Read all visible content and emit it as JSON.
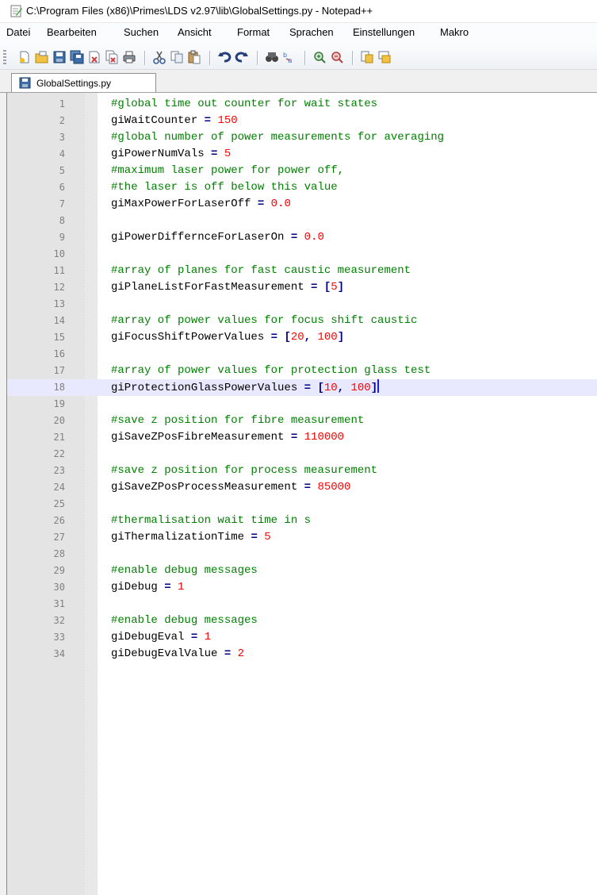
{
  "window": {
    "title": "C:\\Program Files (x86)\\Primes\\LDS v2.97\\lib\\GlobalSettings.py - Notepad++"
  },
  "menubar": {
    "items": [
      "Datei",
      "Bearbeiten",
      "Suchen",
      "Ansicht",
      "Format",
      "Sprachen",
      "Einstellungen",
      "Makro"
    ]
  },
  "toolbar": {
    "icons": [
      "new-file-icon",
      "open-file-icon",
      "save-icon",
      "save-all-icon",
      "close-icon",
      "close-all-icon",
      "print-icon",
      "cut-icon",
      "copy-icon",
      "paste-icon",
      "undo-icon",
      "redo-icon",
      "find-icon",
      "replace-icon",
      "zoom-in-icon",
      "zoom-out-icon",
      "sync-vertical-icon",
      "sync-horizontal-icon"
    ]
  },
  "tab": {
    "label": "GlobalSettings.py"
  },
  "editor": {
    "current_line": 18,
    "lines": [
      {
        "n": "1",
        "t": [
          [
            "c",
            "#global time out counter for wait states"
          ]
        ]
      },
      {
        "n": "2",
        "t": [
          [
            "i",
            "giWaitCounter "
          ],
          [
            "o",
            "="
          ],
          [
            "i",
            " "
          ],
          [
            "n",
            "150"
          ]
        ]
      },
      {
        "n": "3",
        "t": [
          [
            "c",
            "#global number of power measurements for averaging"
          ]
        ]
      },
      {
        "n": "4",
        "t": [
          [
            "i",
            "giPowerNumVals "
          ],
          [
            "o",
            "="
          ],
          [
            "i",
            " "
          ],
          [
            "n",
            "5"
          ]
        ]
      },
      {
        "n": "5",
        "t": [
          [
            "c",
            "#maximum laser power for power off,"
          ]
        ]
      },
      {
        "n": "6",
        "t": [
          [
            "c",
            "#the laser is off below this value"
          ]
        ]
      },
      {
        "n": "7",
        "t": [
          [
            "i",
            "giMaxPowerForLaserOff "
          ],
          [
            "o",
            "="
          ],
          [
            "i",
            " "
          ],
          [
            "n",
            "0.0"
          ]
        ]
      },
      {
        "n": "8",
        "t": []
      },
      {
        "n": "9",
        "t": [
          [
            "i",
            "giPowerDiffernceForLaserOn "
          ],
          [
            "o",
            "="
          ],
          [
            "i",
            " "
          ],
          [
            "n",
            "0.0"
          ]
        ]
      },
      {
        "n": "10",
        "t": []
      },
      {
        "n": "11",
        "t": [
          [
            "c",
            "#array of planes for fast caustic measurement"
          ]
        ]
      },
      {
        "n": "12",
        "t": [
          [
            "i",
            "giPlaneListForFastMeasurement "
          ],
          [
            "o",
            "="
          ],
          [
            "i",
            " "
          ],
          [
            "o",
            "["
          ],
          [
            "n",
            "5"
          ],
          [
            "o",
            "]"
          ]
        ]
      },
      {
        "n": "13",
        "t": []
      },
      {
        "n": "14",
        "t": [
          [
            "c",
            "#array of power values for focus shift caustic"
          ]
        ]
      },
      {
        "n": "15",
        "t": [
          [
            "i",
            "giFocusShiftPowerValues "
          ],
          [
            "o",
            "="
          ],
          [
            "i",
            " "
          ],
          [
            "o",
            "["
          ],
          [
            "n",
            "20"
          ],
          [
            "o",
            ","
          ],
          [
            "i",
            " "
          ],
          [
            "n",
            "100"
          ],
          [
            "o",
            "]"
          ]
        ]
      },
      {
        "n": "16",
        "t": []
      },
      {
        "n": "17",
        "t": [
          [
            "c",
            "#array of power values for protection glass test"
          ]
        ]
      },
      {
        "n": "18",
        "t": [
          [
            "i",
            "giProtectionGlassPowerValues "
          ],
          [
            "o",
            "="
          ],
          [
            "i",
            " "
          ],
          [
            "o",
            "["
          ],
          [
            "n",
            "10"
          ],
          [
            "o",
            ","
          ],
          [
            "i",
            " "
          ],
          [
            "n",
            "100"
          ],
          [
            "o",
            "]"
          ]
        ]
      },
      {
        "n": "19",
        "t": []
      },
      {
        "n": "20",
        "t": [
          [
            "c",
            "#save z position for fibre measurement"
          ]
        ]
      },
      {
        "n": "21",
        "t": [
          [
            "i",
            "giSaveZPosFibreMeasurement "
          ],
          [
            "o",
            "="
          ],
          [
            "i",
            " "
          ],
          [
            "n",
            "110000"
          ]
        ]
      },
      {
        "n": "22",
        "t": []
      },
      {
        "n": "23",
        "t": [
          [
            "c",
            "#save z position for process measurement"
          ]
        ]
      },
      {
        "n": "24",
        "t": [
          [
            "i",
            "giSaveZPosProcessMeasurement "
          ],
          [
            "o",
            "="
          ],
          [
            "i",
            " "
          ],
          [
            "n",
            "85000"
          ]
        ]
      },
      {
        "n": "25",
        "t": []
      },
      {
        "n": "26",
        "t": [
          [
            "c",
            "#thermalisation wait time in s"
          ]
        ]
      },
      {
        "n": "27",
        "t": [
          [
            "i",
            "giThermalizationTime "
          ],
          [
            "o",
            "="
          ],
          [
            "i",
            " "
          ],
          [
            "n",
            "5"
          ]
        ]
      },
      {
        "n": "28",
        "t": []
      },
      {
        "n": "29",
        "t": [
          [
            "c",
            "#enable debug messages"
          ]
        ]
      },
      {
        "n": "30",
        "t": [
          [
            "i",
            "giDebug "
          ],
          [
            "o",
            "="
          ],
          [
            "i",
            " "
          ],
          [
            "n",
            "1"
          ]
        ]
      },
      {
        "n": "31",
        "t": []
      },
      {
        "n": "32",
        "t": [
          [
            "c",
            "#enable debug messages"
          ]
        ]
      },
      {
        "n": "33",
        "t": [
          [
            "i",
            "giDebugEval "
          ],
          [
            "o",
            "="
          ],
          [
            "i",
            " "
          ],
          [
            "n",
            "1"
          ]
        ]
      },
      {
        "n": "34",
        "t": [
          [
            "i",
            "giDebugEvalValue "
          ],
          [
            "o",
            "="
          ],
          [
            "i",
            " "
          ],
          [
            "n",
            "2"
          ]
        ]
      }
    ]
  }
}
